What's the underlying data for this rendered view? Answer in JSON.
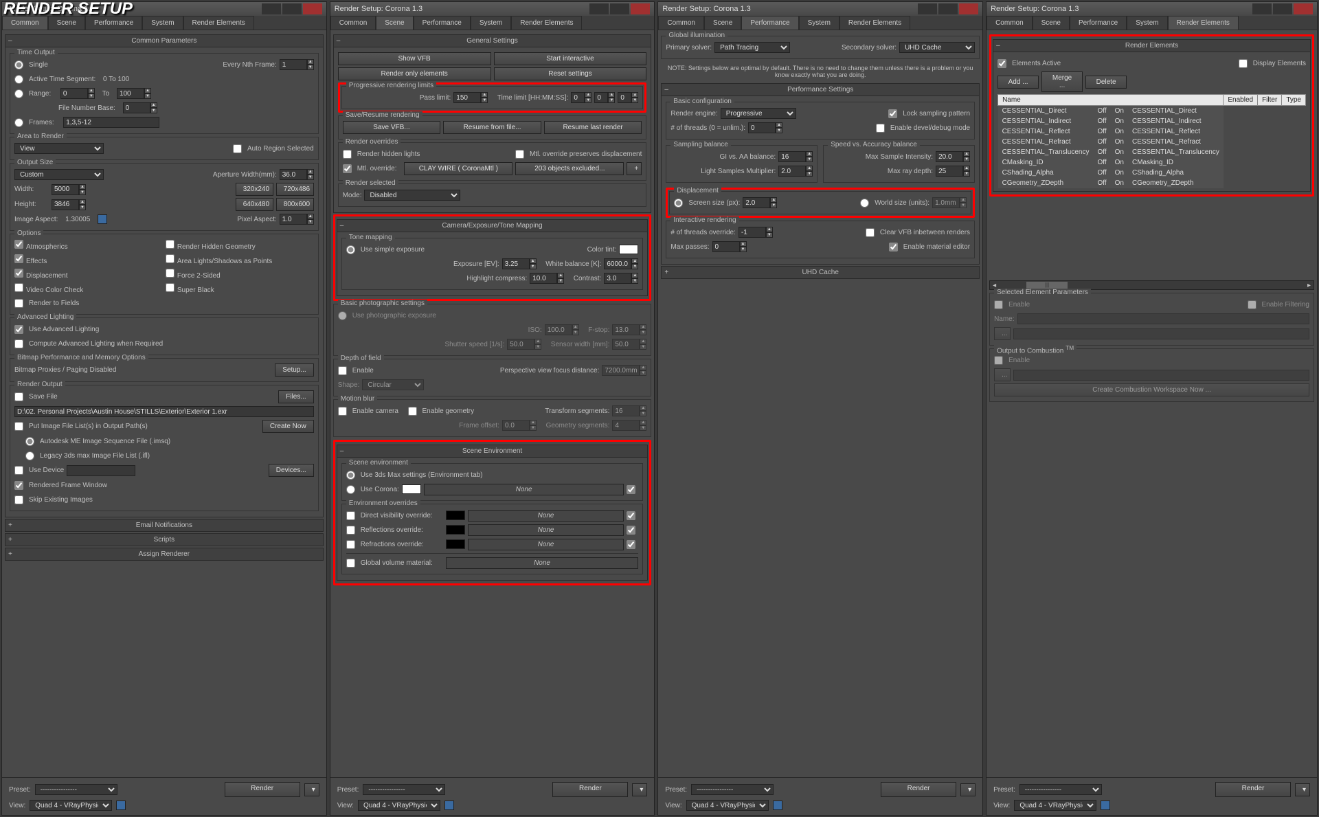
{
  "app_title": "Render Setup: Corona 1.3",
  "watermark": "RENDER SETUP",
  "tabs": [
    "Common",
    "Scene",
    "Performance",
    "System",
    "Render Elements"
  ],
  "footer": {
    "preset_label": "Preset:",
    "view_label": "View:",
    "view_value": "Quad 4 - VRayPhysic",
    "render": "Render"
  },
  "common": {
    "rollouts": {
      "params": "Common Parameters",
      "email": "Email Notifications",
      "scripts": "Scripts",
      "assign": "Assign Renderer"
    },
    "time_output": {
      "title": "Time Output",
      "single": "Single",
      "every_nth": "Every Nth Frame:",
      "every_nth_val": "1",
      "active": "Active Time Segment:",
      "active_range": "0 To 100",
      "range": "Range:",
      "range_from": "0",
      "to": "To",
      "range_to": "100",
      "file_num": "File Number Base:",
      "file_num_val": "0",
      "frames": "Frames:",
      "frames_val": "1,3,5-12"
    },
    "area": {
      "title": "Area to Render",
      "mode": "View",
      "auto_region": "Auto Region Selected"
    },
    "output_size": {
      "title": "Output Size",
      "type": "Custom",
      "aperture": "Aperture Width(mm):",
      "aperture_val": "36.0",
      "width": "Width:",
      "width_val": "5000",
      "height": "Height:",
      "height_val": "3846",
      "presets": [
        "320x240",
        "720x486",
        "640x480",
        "800x600"
      ],
      "image_aspect": "Image Aspect:",
      "image_aspect_val": "1.30005",
      "pixel_aspect": "Pixel Aspect:",
      "pixel_aspect_val": "1.0"
    },
    "options": {
      "title": "Options",
      "atmospherics": "Atmospherics",
      "effects": "Effects",
      "displacement": "Displacement",
      "video_color": "Video Color Check",
      "render_fields": "Render to Fields",
      "hidden_geom": "Render Hidden Geometry",
      "area_lights": "Area Lights/Shadows as Points",
      "force_2sided": "Force 2-Sided",
      "super_black": "Super Black"
    },
    "advanced_lighting": {
      "title": "Advanced Lighting",
      "use": "Use Advanced Lighting",
      "compute": "Compute Advanced Lighting when Required"
    },
    "bitmap_perf": {
      "title": "Bitmap Performance and Memory Options",
      "proxies": "Bitmap Proxies / Paging Disabled",
      "setup": "Setup..."
    },
    "render_output": {
      "title": "Render Output",
      "save": "Save File",
      "files": "Files...",
      "path": "D:\\02. Personal Projects\\Austin House\\STILLS\\Exterior\\Exterior 1.exr",
      "put_list": "Put Image File List(s) in Output Path(s)",
      "create_now": "Create Now",
      "autodesk": "Autodesk ME Image Sequence File (.imsq)",
      "legacy": "Legacy 3ds max Image File List (.ifl)",
      "use_device": "Use Device",
      "devices": "Devices...",
      "rendered_window": "Rendered Frame Window",
      "skip_existing": "Skip Existing Images"
    }
  },
  "scene": {
    "general": {
      "title": "General Settings",
      "show_vfb": "Show VFB",
      "start_interactive": "Start interactive",
      "render_only": "Render only elements",
      "reset": "Reset settings"
    },
    "limits": {
      "title": "Progressive rendering limits",
      "pass_limit": "Pass limit:",
      "pass_val": "150",
      "time_limit": "Time limit [HH:MM:SS]:",
      "h": "0",
      "m": "0",
      "s": "0"
    },
    "save_resume": {
      "title": "Save/Resume rendering",
      "save": "Save VFB...",
      "resume_file": "Resume from file...",
      "resume_last": "Resume last render"
    },
    "overrides": {
      "title": "Render overrides",
      "hidden": "Render hidden lights",
      "mtl_override": "Mtl. override:",
      "mtl_name": "CLAY WIRE  ( CoronaMtl )",
      "excluded": "203 objects excluded...",
      "preserve": "Mtl. override preserves displacement"
    },
    "render_selected": {
      "title": "Render selected",
      "mode": "Mode:",
      "mode_val": "Disabled"
    },
    "camera": {
      "title": "Camera/Exposure/Tone Mapping"
    },
    "tone": {
      "title": "Tone mapping",
      "simple": "Use simple exposure",
      "color_tint": "Color tint:",
      "exposure": "Exposure [EV]:",
      "exposure_val": "3.25",
      "wb": "White balance [K]:",
      "wb_val": "6000.0",
      "highlight": "Highlight compress:",
      "highlight_val": "10.0",
      "contrast": "Contrast:",
      "contrast_val": "3.0"
    },
    "photo": {
      "title": "Basic photographic settings",
      "use": "Use photographic exposure",
      "iso": "ISO:",
      "iso_val": "100.0",
      "fstop": "F-stop:",
      "fstop_val": "13.0",
      "shutter": "Shutter speed [1/s]:",
      "shutter_val": "50.0",
      "sensor": "Sensor width [mm]:",
      "sensor_val": "50.0"
    },
    "dof": {
      "title": "Depth of field",
      "enable": "Enable",
      "persp": "Perspective view focus distance:",
      "persp_val": "7200.0mm",
      "shape": "Shape:",
      "shape_val": "Circular"
    },
    "mblur": {
      "title": "Motion blur",
      "camera": "Enable camera",
      "geometry": "Enable geometry",
      "transform": "Transform segments:",
      "transform_val": "16",
      "offset": "Frame offset:",
      "offset_val": "0.0",
      "geom_seg": "Geometry segments:",
      "geom_val": "4"
    },
    "scene_env": {
      "title": "Scene Environment",
      "scene": "Scene environment",
      "use_max": "Use 3ds Max settings (Environment tab)",
      "use_corona": "Use Corona:",
      "none": "None",
      "env_overrides": "Environment overrides",
      "direct": "Direct visibility override:",
      "reflect": "Reflections override:",
      "refract": "Refractions override:",
      "global_vol": "Global volume material:"
    }
  },
  "performance": {
    "gi": {
      "title": "Global illumination",
      "primary": "Primary solver:",
      "primary_val": "Path Tracing",
      "secondary": "Secondary solver:",
      "secondary_val": "UHD Cache"
    },
    "note": "NOTE: Settings below are optimal by default. There is no need to change them unless there is a problem or you know exactly what you are doing.",
    "perf": {
      "title": "Performance Settings"
    },
    "basic": {
      "title": "Basic configuration",
      "engine": "Render engine:",
      "engine_val": "Progressive",
      "lock": "Lock sampling pattern",
      "threads": "# of threads (0 = unlim.):",
      "threads_val": "0",
      "devel": "Enable devel/debug mode"
    },
    "sampling": {
      "title": "Sampling balance",
      "gi_aa": "GI vs. AA balance:",
      "gi_val": "16",
      "light_mul": "Light Samples Multiplier:",
      "light_val": "2.0"
    },
    "speed": {
      "title": "Speed vs. Accuracy balance",
      "max_sample": "Max Sample Intensity:",
      "max_sample_val": "20.0",
      "max_ray": "Max ray depth:",
      "max_ray_val": "25"
    },
    "displacement": {
      "title": "Displacement",
      "screen": "Screen size (px):",
      "screen_val": "2.0",
      "world": "World size (units):",
      "world_val": "1.0mm"
    },
    "interactive": {
      "title": "Interactive rendering",
      "threads_override": "# of threads override:",
      "threads_val": "-1",
      "clear_vfb": "Clear VFB inbetween renders",
      "max_passes": "Max passes:",
      "max_passes_val": "0",
      "material_editor": "Enable material editor"
    },
    "uhd": {
      "title": "UHD Cache"
    }
  },
  "render_elements": {
    "title": "Render Elements",
    "elements_active": "Elements Active",
    "display_elements": "Display Elements",
    "add": "Add ...",
    "merge": "Merge ...",
    "delete": "Delete",
    "headers": {
      "name": "Name",
      "enabled": "Enabled",
      "filter": "Filter",
      "type": "Type"
    },
    "rows": [
      {
        "name": "CESSENTIAL_Direct",
        "enabled": "Off",
        "filter": "On",
        "type": "CESSENTIAL_Direct"
      },
      {
        "name": "CESSENTIAL_Indirect",
        "enabled": "Off",
        "filter": "On",
        "type": "CESSENTIAL_Indirect"
      },
      {
        "name": "CESSENTIAL_Reflect",
        "enabled": "Off",
        "filter": "On",
        "type": "CESSENTIAL_Reflect"
      },
      {
        "name": "CESSENTIAL_Refract",
        "enabled": "Off",
        "filter": "On",
        "type": "CESSENTIAL_Refract"
      },
      {
        "name": "CESSENTIAL_Translucency",
        "enabled": "Off",
        "filter": "On",
        "type": "CESSENTIAL_Translucency"
      },
      {
        "name": "CMasking_ID",
        "enabled": "Off",
        "filter": "On",
        "type": "CMasking_ID"
      },
      {
        "name": "CShading_Alpha",
        "enabled": "Off",
        "filter": "On",
        "type": "CShading_Alpha"
      },
      {
        "name": "CGeometry_ZDepth",
        "enabled": "Off",
        "filter": "On",
        "type": "CGeometry_ZDepth"
      }
    ],
    "selected_params": "Selected Element Parameters",
    "enable": "Enable",
    "enable_filtering": "Enable Filtering",
    "name_lbl": "Name:",
    "dots": "...",
    "output_to": "Output to Combustion",
    "tm": "TM",
    "create_workspace": "Create Combustion Workspace Now ..."
  }
}
